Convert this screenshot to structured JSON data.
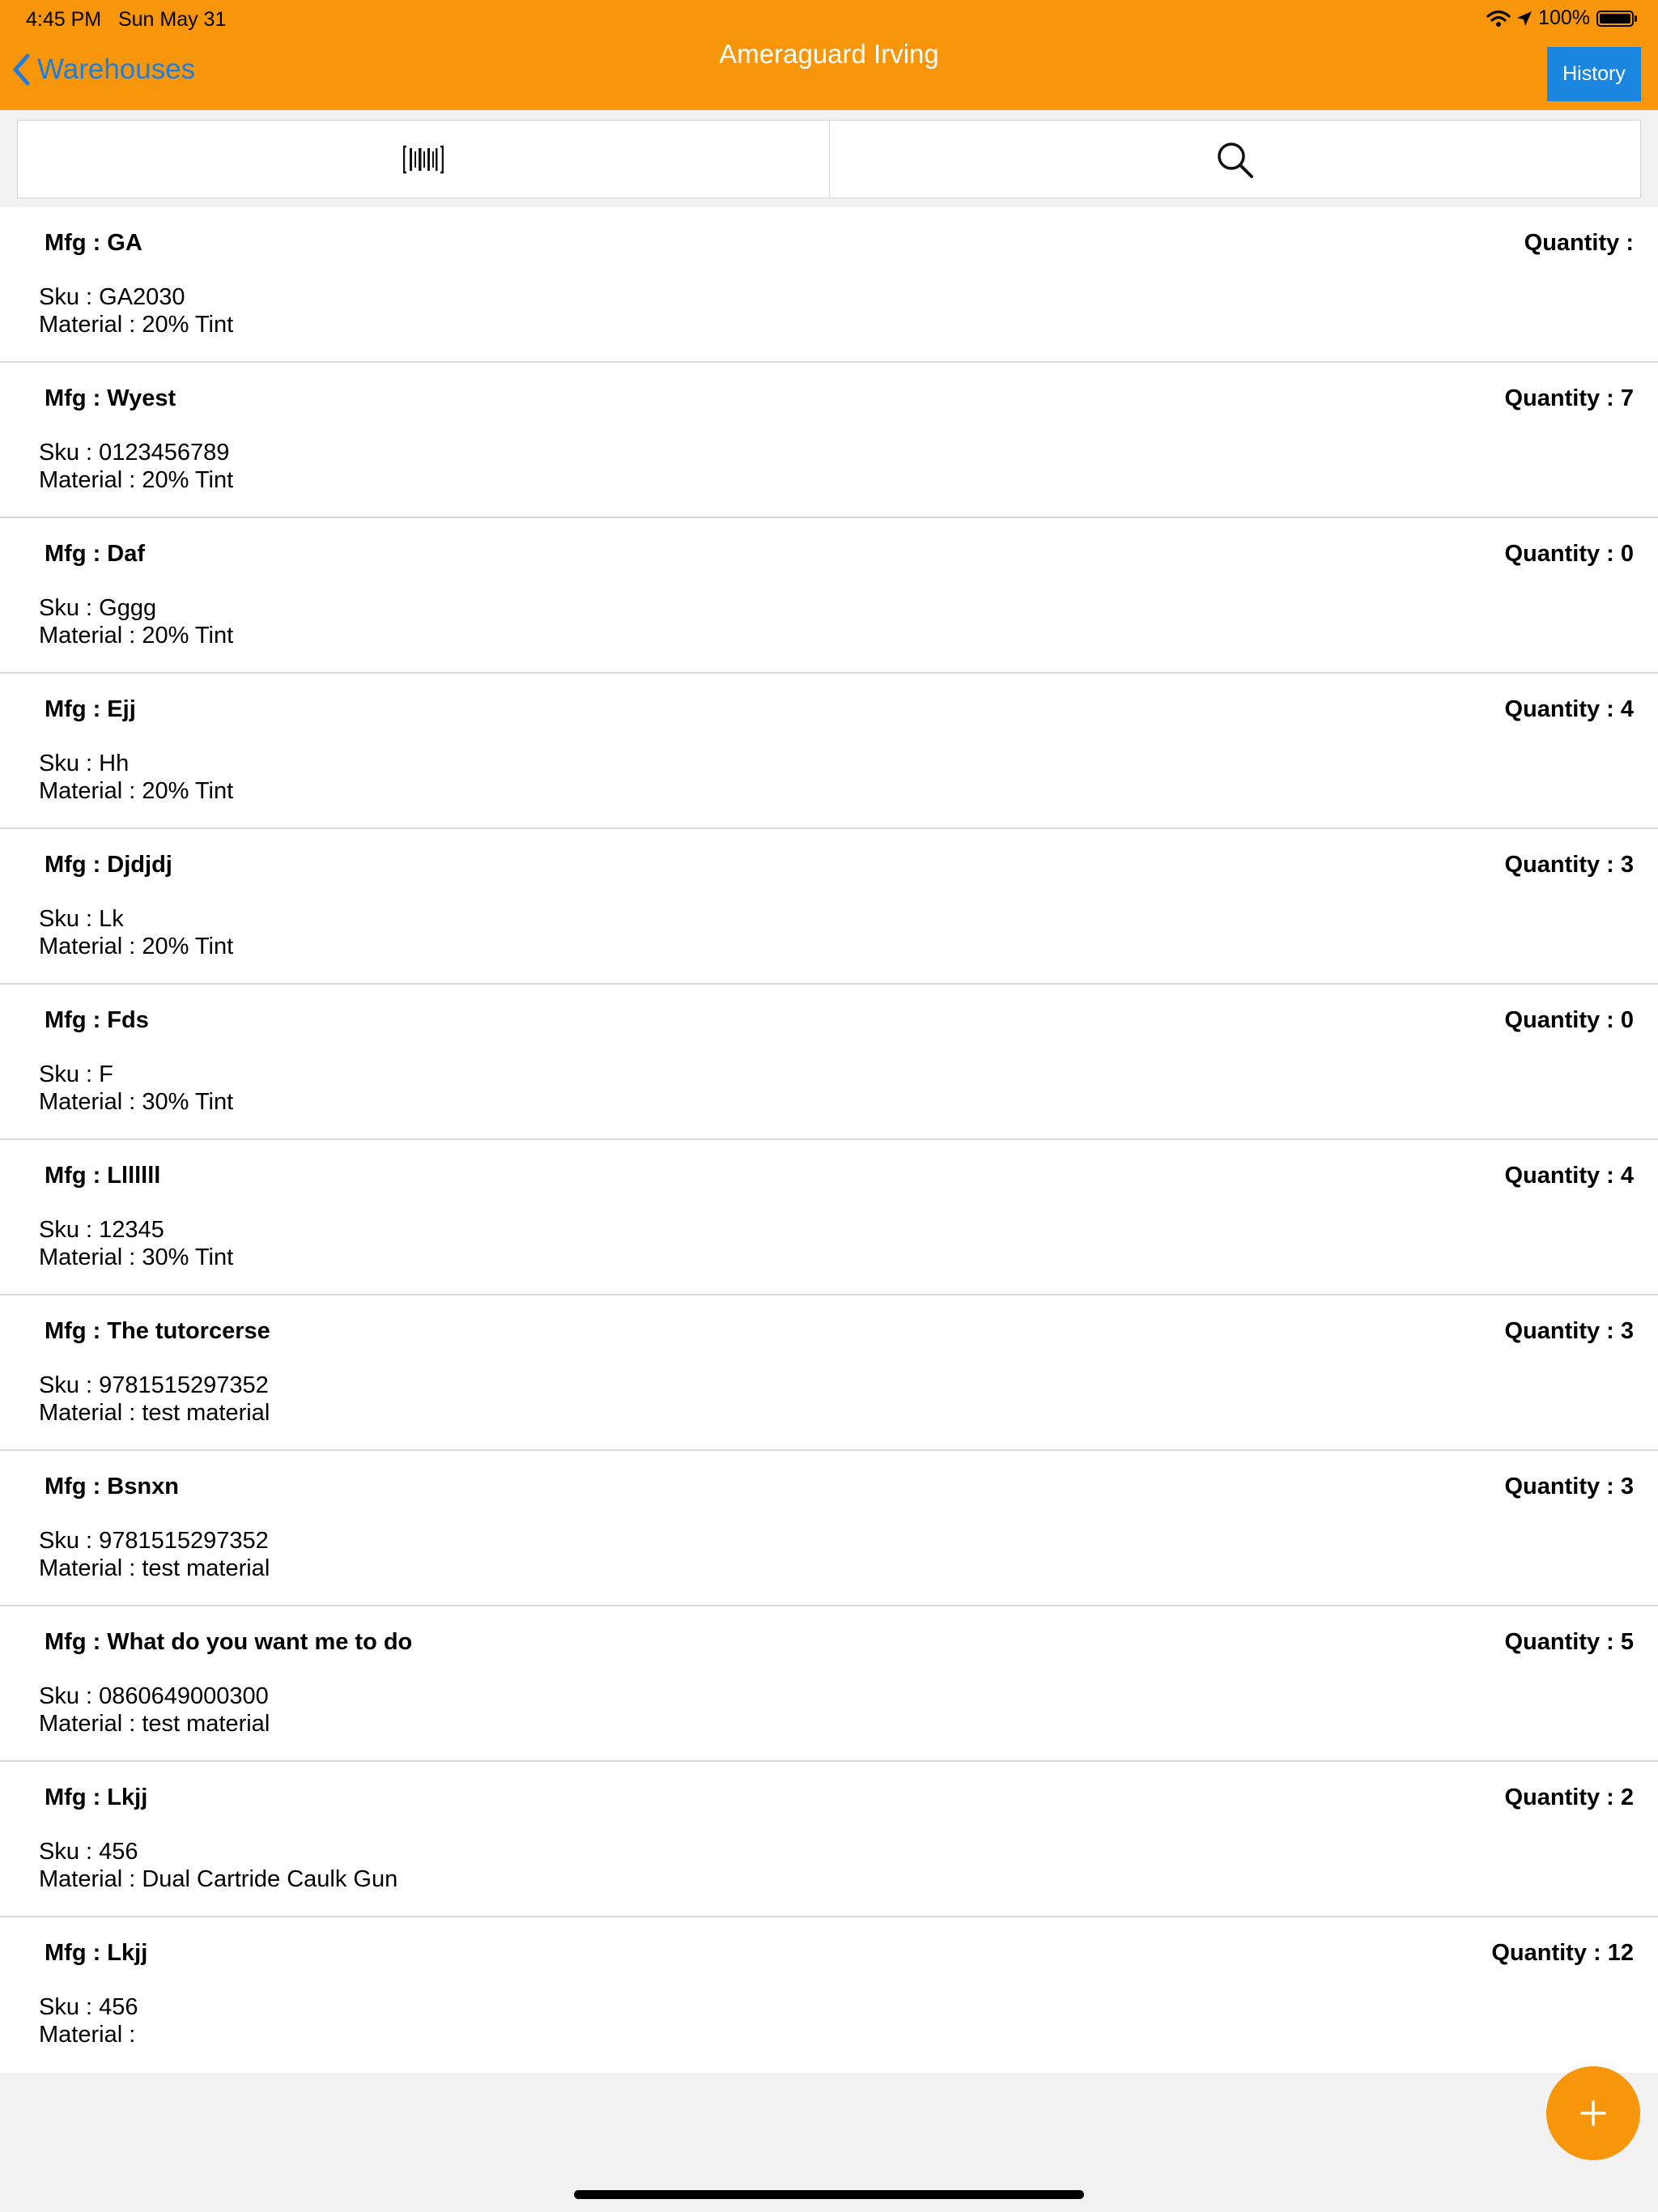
{
  "status_bar": {
    "time": "4:45 PM",
    "date": "Sun May 31",
    "battery": "100%"
  },
  "nav": {
    "back_label": "Warehouses",
    "title": "Ameraguard Irving",
    "history_label": "History"
  },
  "colors": {
    "header": "#f7960b",
    "back_link": "#1f7ddb",
    "history_button": "#1a86e0",
    "fab": "#f7960b"
  },
  "toolbar": {
    "scan_icon": "barcode-icon",
    "search_icon": "search-icon"
  },
  "items": [
    {
      "mfg": "Mfg : GA",
      "quantity": "Quantity :",
      "sku": "Sku : GA2030",
      "material": "Material : 20% Tint"
    },
    {
      "mfg": "Mfg : Wyest",
      "quantity": "Quantity : 7",
      "sku": "Sku : 0123456789",
      "material": "Material : 20% Tint"
    },
    {
      "mfg": "Mfg : Daf",
      "quantity": "Quantity : 0",
      "sku": "Sku : Gggg",
      "material": "Material : 20% Tint"
    },
    {
      "mfg": "Mfg : Ejj",
      "quantity": "Quantity : 4",
      "sku": "Sku : Hh",
      "material": "Material : 20% Tint"
    },
    {
      "mfg": "Mfg : Djdjdj",
      "quantity": "Quantity : 3",
      "sku": "Sku : Lk",
      "material": "Material : 20% Tint"
    },
    {
      "mfg": "Mfg : Fds",
      "quantity": "Quantity : 0",
      "sku": "Sku : F",
      "material": "Material : 30% Tint"
    },
    {
      "mfg": "Mfg : Lllllll",
      "quantity": "Quantity : 4",
      "sku": "Sku : 12345",
      "material": "Material : 30% Tint"
    },
    {
      "mfg": "Mfg : The tutorcerse",
      "quantity": "Quantity : 3",
      "sku": "Sku : 9781515297352",
      "material": "Material : test material"
    },
    {
      "mfg": "Mfg : Bsnxn",
      "quantity": "Quantity : 3",
      "sku": "Sku : 9781515297352",
      "material": "Material : test material"
    },
    {
      "mfg": "Mfg : What do you want me to do",
      "quantity": "Quantity : 5",
      "sku": "Sku : 0860649000300",
      "material": "Material : test material"
    },
    {
      "mfg": "Mfg : Lkjj",
      "quantity": "Quantity : 2",
      "sku": "Sku : 456",
      "material": "Material : Dual Cartride Caulk Gun"
    },
    {
      "mfg": "Mfg : Lkjj",
      "quantity": "Quantity : 12",
      "sku": "Sku : 456",
      "material": "Material :"
    }
  ],
  "fab": {
    "icon": "plus-icon"
  }
}
